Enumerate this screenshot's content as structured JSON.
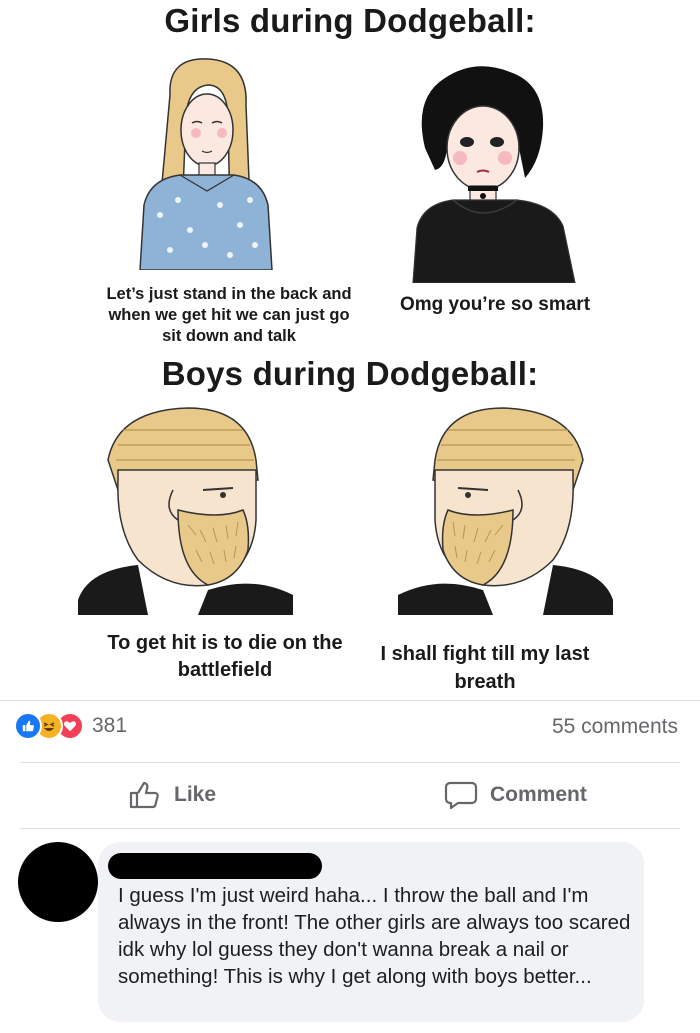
{
  "meme": {
    "title_top": "Girls during Dodgeball:",
    "girl1_caption": "Let’s just stand in the back and when we get hit we can just go sit down and talk",
    "girl2_caption": "Omg you’re so smart",
    "title_bottom": "Boys during Dodgeball:",
    "boy1_caption": "To get hit is to die on the battlefield",
    "boy2_caption": "I shall fight till my last breath"
  },
  "reactions": {
    "icons": [
      "like-icon",
      "haha-icon",
      "love-icon"
    ],
    "count": "381"
  },
  "comments_count": "55 comments",
  "actions": {
    "like_label": "Like",
    "comment_label": "Comment"
  },
  "comment": {
    "text": "I guess I'm just weird haha... I throw the ball and I'm always in the front! The other girls are always too scared idk why lol guess they don't wanna break a nail or something! This is why I get along with boys better..."
  },
  "colors": {
    "like_blue": "#1877f2",
    "haha_yellow": "#f7b125",
    "love_red": "#f33e58",
    "secondary_text": "#65676b",
    "bubble_bg": "#f0f2f5",
    "hair_blonde": "#e8c98a",
    "blouse_blue": "#8fb3d6"
  }
}
